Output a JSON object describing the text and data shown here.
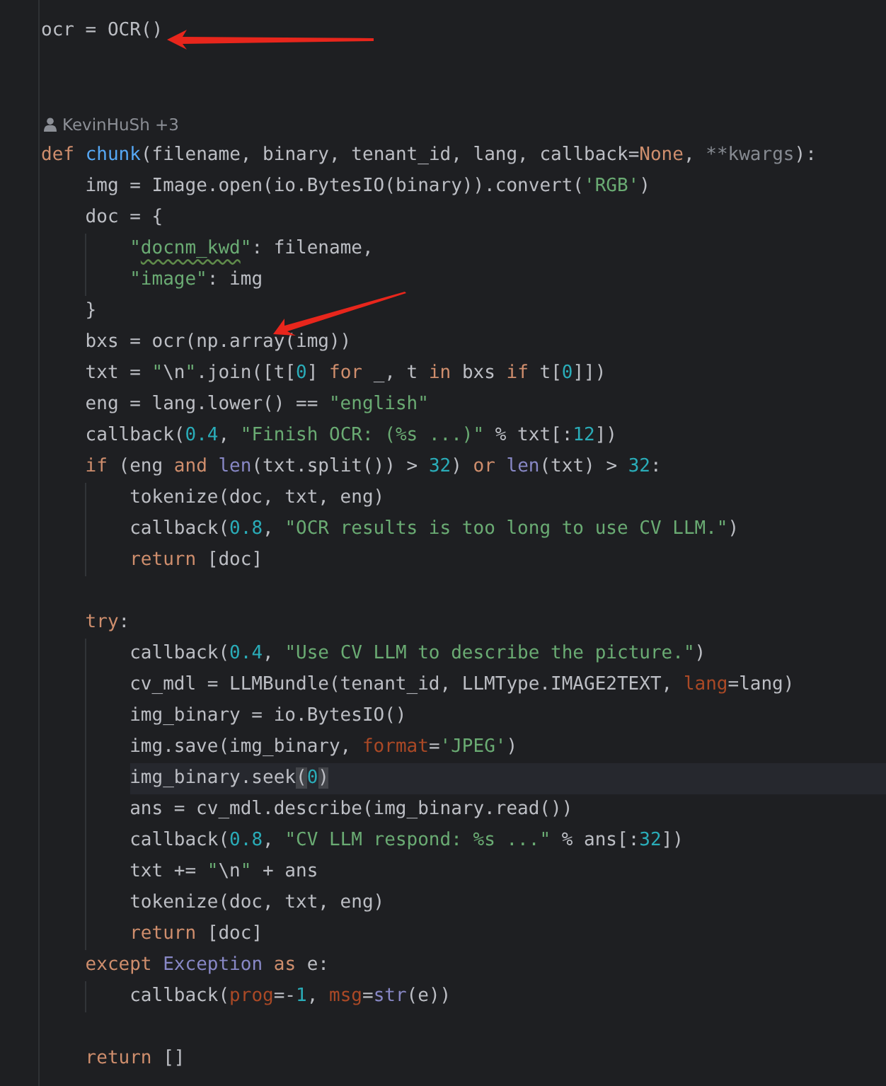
{
  "editor": {
    "lines": [
      {
        "kind": "code",
        "current": false,
        "tokens": [
          {
            "text": "ocr = OCR()",
            "kind": "plain"
          }
        ]
      },
      {
        "kind": "blank"
      },
      {
        "kind": "blank"
      },
      {
        "kind": "author",
        "text": "KevinHuSh +3"
      },
      {
        "kind": "code",
        "current": false,
        "tokens": [
          {
            "text": "def ",
            "kind": "keyword"
          },
          {
            "text": "chunk",
            "kind": "function"
          },
          {
            "text": "(filename, binary, tenant_id, lang, callback=",
            "kind": "plain"
          },
          {
            "text": "None",
            "kind": "keyword"
          },
          {
            "text": ", ",
            "kind": "plain"
          },
          {
            "text": "**kwargs",
            "kind": "unused"
          },
          {
            "text": "):",
            "kind": "plain"
          }
        ],
        "children": [
          {
            "kind": "code",
            "current": false,
            "tokens": [
              {
                "text": "img = Image.open(io.BytesIO(binary)).convert(",
                "kind": "plain"
              },
              {
                "text": "'RGB'",
                "kind": "string"
              },
              {
                "text": ")",
                "kind": "plain"
              }
            ]
          },
          {
            "kind": "code",
            "current": false,
            "tokens": [
              {
                "text": "doc = {",
                "kind": "plain"
              }
            ],
            "children": [
              {
                "kind": "code",
                "current": false,
                "tokens": [
                  {
                    "text": "\"",
                    "kind": "string"
                  },
                  {
                    "text": "docnm_kwd",
                    "kind": "string_typo"
                  },
                  {
                    "text": "\"",
                    "kind": "string"
                  },
                  {
                    "text": ": filename,",
                    "kind": "plain"
                  }
                ]
              },
              {
                "kind": "code",
                "current": false,
                "tokens": [
                  {
                    "text": "\"image\"",
                    "kind": "string"
                  },
                  {
                    "text": ": img",
                    "kind": "plain"
                  }
                ]
              }
            ]
          },
          {
            "kind": "code",
            "current": false,
            "tokens": [
              {
                "text": "}",
                "kind": "plain"
              }
            ]
          },
          {
            "kind": "code",
            "current": false,
            "tokens": [
              {
                "text": "bxs = ocr(np.array(img))",
                "kind": "plain"
              }
            ]
          },
          {
            "kind": "code",
            "current": false,
            "tokens": [
              {
                "text": "txt = ",
                "kind": "plain"
              },
              {
                "text": "\"",
                "kind": "string"
              },
              {
                "text": "\\n",
                "kind": "escape"
              },
              {
                "text": "\"",
                "kind": "string"
              },
              {
                "text": ".join([t[",
                "kind": "plain"
              },
              {
                "text": "0",
                "kind": "number"
              },
              {
                "text": "] ",
                "kind": "plain"
              },
              {
                "text": "for",
                "kind": "keyword"
              },
              {
                "text": " _, t ",
                "kind": "plain"
              },
              {
                "text": "in",
                "kind": "keyword"
              },
              {
                "text": " bxs ",
                "kind": "plain"
              },
              {
                "text": "if",
                "kind": "keyword"
              },
              {
                "text": " t[",
                "kind": "plain"
              },
              {
                "text": "0",
                "kind": "number"
              },
              {
                "text": "]])",
                "kind": "plain"
              }
            ]
          },
          {
            "kind": "code",
            "current": false,
            "tokens": [
              {
                "text": "eng = lang.lower() == ",
                "kind": "plain"
              },
              {
                "text": "\"english\"",
                "kind": "string"
              }
            ]
          },
          {
            "kind": "code",
            "current": false,
            "tokens": [
              {
                "text": "callback(",
                "kind": "plain"
              },
              {
                "text": "0.4",
                "kind": "number"
              },
              {
                "text": ", ",
                "kind": "plain"
              },
              {
                "text": "\"Finish OCR: (%s ...)\"",
                "kind": "string"
              },
              {
                "text": " % txt[:",
                "kind": "plain"
              },
              {
                "text": "12",
                "kind": "number"
              },
              {
                "text": "])",
                "kind": "plain"
              }
            ]
          },
          {
            "kind": "code",
            "current": false,
            "tokens": [
              {
                "text": "if",
                "kind": "keyword"
              },
              {
                "text": " (eng ",
                "kind": "plain"
              },
              {
                "text": "and ",
                "kind": "keyword"
              },
              {
                "text": "len",
                "kind": "builtin"
              },
              {
                "text": "(txt.split()) > ",
                "kind": "plain"
              },
              {
                "text": "32",
                "kind": "number"
              },
              {
                "text": ") ",
                "kind": "plain"
              },
              {
                "text": "or ",
                "kind": "keyword"
              },
              {
                "text": "len",
                "kind": "builtin"
              },
              {
                "text": "(txt) > ",
                "kind": "plain"
              },
              {
                "text": "32",
                "kind": "number"
              },
              {
                "text": ":",
                "kind": "plain"
              }
            ],
            "children": [
              {
                "kind": "code",
                "current": false,
                "tokens": [
                  {
                    "text": "tokenize(doc, txt, eng)",
                    "kind": "plain"
                  }
                ]
              },
              {
                "kind": "code",
                "current": false,
                "tokens": [
                  {
                    "text": "callback(",
                    "kind": "plain"
                  },
                  {
                    "text": "0.8",
                    "kind": "number"
                  },
                  {
                    "text": ", ",
                    "kind": "plain"
                  },
                  {
                    "text": "\"OCR results is too long to use CV LLM.\"",
                    "kind": "string"
                  },
                  {
                    "text": ")",
                    "kind": "plain"
                  }
                ]
              },
              {
                "kind": "code",
                "current": false,
                "tokens": [
                  {
                    "text": "return",
                    "kind": "keyword"
                  },
                  {
                    "text": " [doc]",
                    "kind": "plain"
                  }
                ]
              }
            ]
          },
          {
            "kind": "blank"
          },
          {
            "kind": "code",
            "current": false,
            "tokens": [
              {
                "text": "try",
                "kind": "keyword"
              },
              {
                "text": ":",
                "kind": "plain"
              }
            ],
            "children": [
              {
                "kind": "code",
                "current": false,
                "tokens": [
                  {
                    "text": "callback(",
                    "kind": "plain"
                  },
                  {
                    "text": "0.4",
                    "kind": "number"
                  },
                  {
                    "text": ", ",
                    "kind": "plain"
                  },
                  {
                    "text": "\"Use CV LLM to describe the picture.\"",
                    "kind": "string"
                  },
                  {
                    "text": ")",
                    "kind": "plain"
                  }
                ]
              },
              {
                "kind": "code",
                "current": false,
                "tokens": [
                  {
                    "text": "cv_mdl = LLMBundle(tenant_id, LLMType.IMAGE2TEXT, ",
                    "kind": "plain"
                  },
                  {
                    "text": "lang",
                    "kind": "named_arg"
                  },
                  {
                    "text": "=lang)",
                    "kind": "plain"
                  }
                ]
              },
              {
                "kind": "code",
                "current": false,
                "tokens": [
                  {
                    "text": "img_binary = io.BytesIO()",
                    "kind": "plain"
                  }
                ]
              },
              {
                "kind": "code",
                "current": false,
                "tokens": [
                  {
                    "text": "img.save(img_binary, ",
                    "kind": "plain"
                  },
                  {
                    "text": "format",
                    "kind": "named_arg"
                  },
                  {
                    "text": "=",
                    "kind": "plain"
                  },
                  {
                    "text": "'JPEG'",
                    "kind": "string"
                  },
                  {
                    "text": ")",
                    "kind": "plain"
                  }
                ]
              },
              {
                "kind": "code",
                "current": true,
                "tokens": [
                  {
                    "text": "img_binary.seek",
                    "kind": "plain"
                  },
                  {
                    "text": "(",
                    "kind": "brace_match"
                  },
                  {
                    "text": "0",
                    "kind": "number"
                  },
                  {
                    "text": ")",
                    "kind": "brace_match"
                  }
                ]
              },
              {
                "kind": "code",
                "current": false,
                "tokens": [
                  {
                    "text": "ans = cv_mdl.describe(img_binary.read())",
                    "kind": "plain"
                  }
                ]
              },
              {
                "kind": "code",
                "current": false,
                "tokens": [
                  {
                    "text": "callback(",
                    "kind": "plain"
                  },
                  {
                    "text": "0.8",
                    "kind": "number"
                  },
                  {
                    "text": ", ",
                    "kind": "plain"
                  },
                  {
                    "text": "\"CV LLM respond: %s ...\"",
                    "kind": "string"
                  },
                  {
                    "text": " % ans[:",
                    "kind": "plain"
                  },
                  {
                    "text": "32",
                    "kind": "number"
                  },
                  {
                    "text": "])",
                    "kind": "plain"
                  }
                ]
              },
              {
                "kind": "code",
                "current": false,
                "tokens": [
                  {
                    "text": "txt += ",
                    "kind": "plain"
                  },
                  {
                    "text": "\"",
                    "kind": "string"
                  },
                  {
                    "text": "\\n",
                    "kind": "escape"
                  },
                  {
                    "text": "\"",
                    "kind": "string"
                  },
                  {
                    "text": " + ans",
                    "kind": "plain"
                  }
                ]
              },
              {
                "kind": "code",
                "current": false,
                "tokens": [
                  {
                    "text": "tokenize(doc, txt, eng)",
                    "kind": "plain"
                  }
                ]
              },
              {
                "kind": "code",
                "current": false,
                "tokens": [
                  {
                    "text": "return",
                    "kind": "keyword"
                  },
                  {
                    "text": " [doc]",
                    "kind": "plain"
                  }
                ]
              }
            ]
          },
          {
            "kind": "code",
            "current": false,
            "tokens": [
              {
                "text": "except ",
                "kind": "keyword"
              },
              {
                "text": "Exception ",
                "kind": "builtin"
              },
              {
                "text": "as",
                "kind": "keyword"
              },
              {
                "text": " e:",
                "kind": "plain"
              }
            ],
            "children": [
              {
                "kind": "code",
                "current": false,
                "tokens": [
                  {
                    "text": "callback(",
                    "kind": "plain"
                  },
                  {
                    "text": "prog",
                    "kind": "named_arg"
                  },
                  {
                    "text": "=-",
                    "kind": "plain"
                  },
                  {
                    "text": "1",
                    "kind": "number"
                  },
                  {
                    "text": ", ",
                    "kind": "plain"
                  },
                  {
                    "text": "msg",
                    "kind": "named_arg"
                  },
                  {
                    "text": "=",
                    "kind": "plain"
                  },
                  {
                    "text": "str",
                    "kind": "builtin"
                  },
                  {
                    "text": "(e))",
                    "kind": "plain"
                  }
                ]
              }
            ]
          },
          {
            "kind": "blank"
          },
          {
            "kind": "code",
            "current": false,
            "tokens": [
              {
                "text": "return",
                "kind": "keyword"
              },
              {
                "text": " []",
                "kind": "plain"
              }
            ]
          }
        ]
      }
    ]
  }
}
